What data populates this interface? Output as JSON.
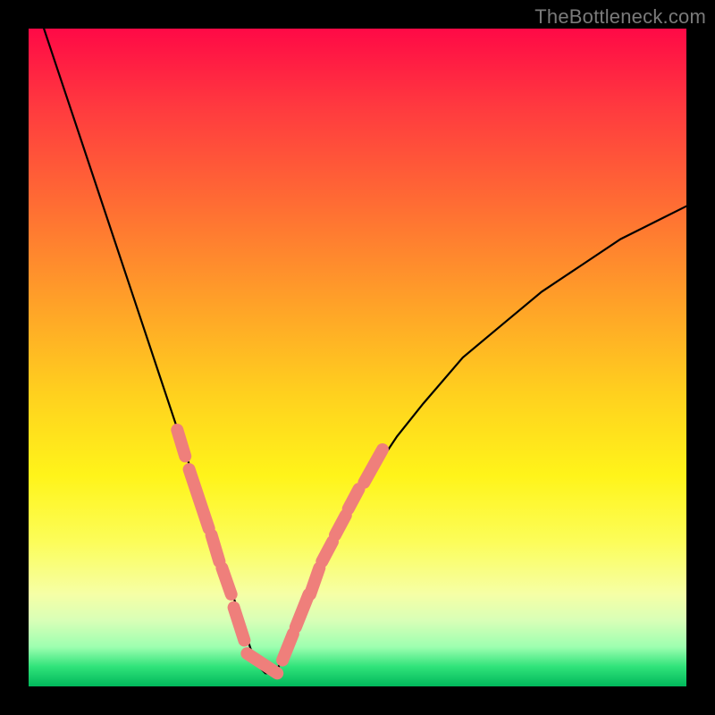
{
  "watermark": "TheBottleneck.com",
  "colors": {
    "black": "#000000",
    "pink_marker": "#ef7f7b",
    "gradient_top": "#ff0946",
    "gradient_bottom": "#01b85b"
  },
  "chart_data": {
    "type": "line",
    "title": "",
    "xlabel": "",
    "ylabel": "",
    "xlim": [
      0,
      100
    ],
    "ylim": [
      0,
      100
    ],
    "x": [
      0,
      4,
      8,
      12,
      16,
      20,
      22,
      24,
      26,
      28,
      30,
      31,
      32,
      33,
      34,
      35,
      36,
      37,
      38,
      40,
      42,
      44,
      48,
      52,
      56,
      60,
      66,
      72,
      78,
      84,
      90,
      96,
      100
    ],
    "values": [
      107,
      95,
      83,
      71,
      59,
      47,
      41,
      35,
      29,
      23,
      17,
      14,
      11,
      8,
      5,
      3,
      2,
      2,
      3,
      7,
      12,
      17,
      25,
      32,
      38,
      43,
      50,
      55,
      60,
      64,
      68,
      71,
      73
    ],
    "series": [
      {
        "name": "bottleneck-curve",
        "color": "#000000",
        "x": [
          0,
          4,
          8,
          12,
          16,
          20,
          22,
          24,
          26,
          28,
          30,
          31,
          32,
          33,
          34,
          35,
          36,
          37,
          38,
          40,
          42,
          44,
          48,
          52,
          56,
          60,
          66,
          72,
          78,
          84,
          90,
          96,
          100
        ],
        "y": [
          107,
          95,
          83,
          71,
          59,
          47,
          41,
          35,
          29,
          23,
          17,
          14,
          11,
          8,
          5,
          3,
          2,
          2,
          3,
          7,
          12,
          17,
          25,
          32,
          38,
          43,
          50,
          55,
          60,
          64,
          68,
          71,
          73
        ]
      },
      {
        "name": "highlight-dashes",
        "color": "#ef7f7b",
        "segments": [
          {
            "x": [
              22.6,
              23.8
            ],
            "y": [
              39,
              35
            ]
          },
          {
            "x": [
              24.4,
              27.4
            ],
            "y": [
              33,
              24
            ]
          },
          {
            "x": [
              27.8,
              29.0
            ],
            "y": [
              23,
              19
            ]
          },
          {
            "x": [
              29.4,
              30.8
            ],
            "y": [
              18,
              14
            ]
          },
          {
            "x": [
              31.2,
              32.8
            ],
            "y": [
              12,
              7
            ]
          },
          {
            "x": [
              33.2,
              37.8
            ],
            "y": [
              5,
              2
            ]
          },
          {
            "x": [
              38.6,
              40.2
            ],
            "y": [
              4,
              8
            ]
          },
          {
            "x": [
              40.6,
              42.6
            ],
            "y": [
              9,
              14
            ]
          },
          {
            "x": [
              42.8,
              44.2
            ],
            "y": [
              14,
              18
            ]
          },
          {
            "x": [
              44.6,
              46.2
            ],
            "y": [
              19,
              22
            ]
          },
          {
            "x": [
              46.6,
              48.2
            ],
            "y": [
              23,
              26
            ]
          },
          {
            "x": [
              48.6,
              50.2
            ],
            "y": [
              27,
              30
            ]
          },
          {
            "x": [
              51.0,
              53.8
            ],
            "y": [
              31,
              36
            ]
          }
        ]
      }
    ]
  }
}
